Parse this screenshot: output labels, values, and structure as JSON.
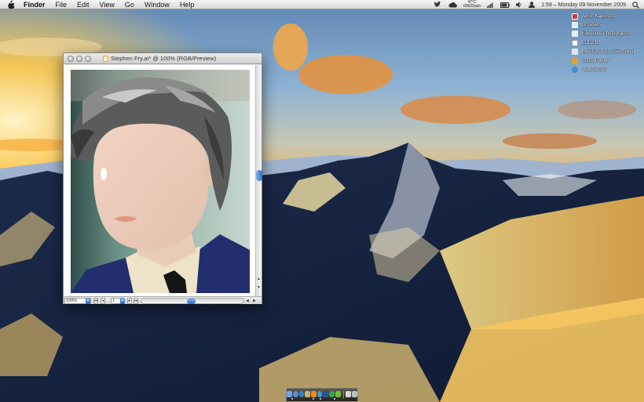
{
  "menubar": {
    "app_name": "Finder",
    "menus": [
      "File",
      "Edit",
      "View",
      "Go",
      "Window",
      "Help"
    ],
    "weather_temp": "47°C",
    "weather_label": "60625rain",
    "clock": "1:59 – Monday 09 November 2009",
    "icons": [
      "apple-icon",
      "twitter-bird-icon",
      "cloud-icon",
      "signal-bars-icon",
      "battery-icon",
      "volume-icon",
      "user-icon",
      "spotlight-icon"
    ]
  },
  "desktop": {
    "items": [
      {
        "label": "Anish Kapor.psd",
        "icon": "psd-file-icon",
        "color": "#c93a3a"
      },
      {
        "label": "Browsers",
        "icon": "folder-icon",
        "color": "#e8edf5"
      },
      {
        "label": "Favourite Photographs",
        "icon": "folder-icon",
        "color": "#e8edf5"
      },
      {
        "label": "LOLZ.txt",
        "icon": "text-file-icon",
        "color": "#ffffff"
      },
      {
        "label": "Mac OS X 1...s Technical",
        "icon": "document-icon",
        "color": "#dfe4ec"
      },
      {
        "label": "School Work",
        "icon": "school-icon",
        "color": "#d9a531"
      },
      {
        "label": "Web Server",
        "icon": "globe-icon",
        "color": "#3d8fd6"
      }
    ]
  },
  "window": {
    "title": "Stephen Fry.ai* @ 100% (RGB/Preview)",
    "zoom": "100%",
    "page": "1",
    "icons": [
      "illustrator-file-icon"
    ]
  },
  "dock": {
    "apps": [
      {
        "name": "finder-icon",
        "color": "#6aa7e8"
      },
      {
        "name": "mail-icon",
        "color": "#5b8fd0"
      },
      {
        "name": "safari-icon",
        "color": "#2f86d6"
      },
      {
        "name": "preview-icon",
        "color": "#c9b27a"
      },
      {
        "name": "illustrator-icon",
        "color": "#f28b1e"
      },
      {
        "name": "itunes-icon",
        "color": "#3aa0e0"
      },
      {
        "name": "photoshop-icon",
        "color": "#1d5aa6"
      },
      {
        "name": "chrome-icon",
        "color": "#35a84a"
      },
      {
        "name": "leaf-icon",
        "color": "#6dbd3f"
      },
      {
        "name": "terminal-icon",
        "color": "#d8d8d8"
      },
      {
        "name": "trash-icon",
        "color": "#b9c3cc"
      }
    ]
  }
}
